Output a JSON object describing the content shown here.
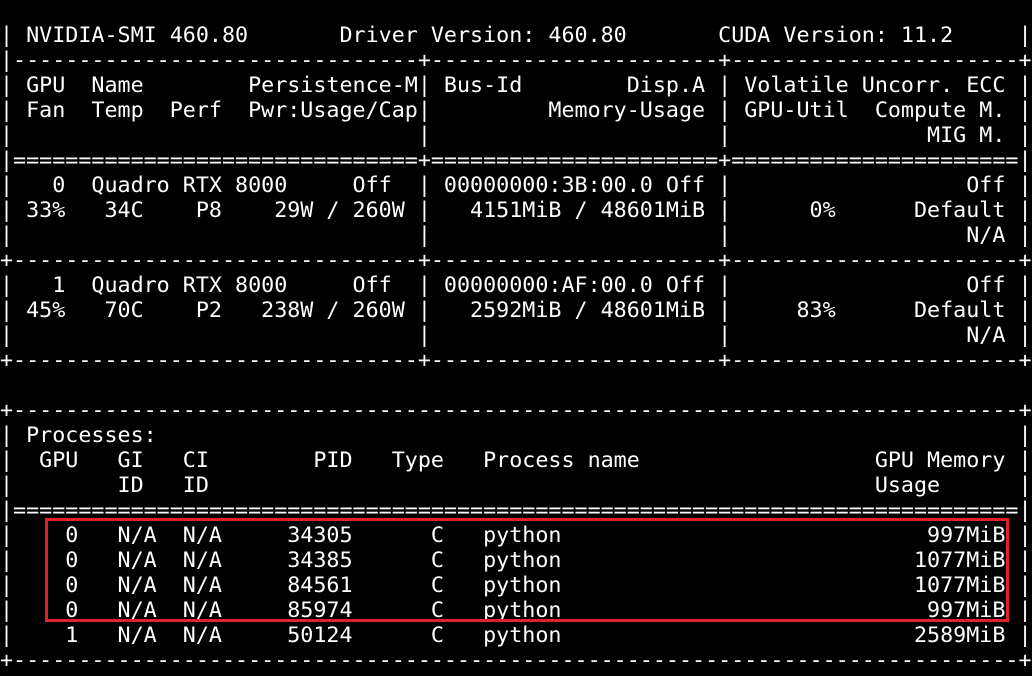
{
  "terminal": {
    "lines": [
      "| NVIDIA-SMI 460.80       Driver Version: 460.80       CUDA Version: 11.2     |",
      "|-------------------------------+----------------------+----------------------+",
      "| GPU  Name        Persistence-M| Bus-Id        Disp.A | Volatile Uncorr. ECC |",
      "| Fan  Temp  Perf  Pwr:Usage/Cap|         Memory-Usage | GPU-Util  Compute M. |",
      "|                               |                      |               MIG M. |",
      "|===============================+======================+======================|",
      "|   0  Quadro RTX 8000     Off  | 00000000:3B:00.0 Off |                  Off |",
      "| 33%   34C    P8    29W / 260W |   4151MiB / 48601MiB |      0%      Default |",
      "|                               |                      |                  N/A |",
      "+-------------------------------+----------------------+----------------------+",
      "|   1  Quadro RTX 8000     Off  | 00000000:AF:00.0 Off |                  Off |",
      "| 45%   70C    P2   238W / 260W |   2592MiB / 48601MiB |     83%      Default |",
      "|                               |                      |                  N/A |",
      "+-------------------------------+----------------------+----------------------+",
      "",
      "+-----------------------------------------------------------------------------+",
      "| Processes:                                                                  |",
      "|  GPU   GI   CI        PID   Type   Process name                  GPU Memory |",
      "|        ID   ID                                                   Usage      |",
      "|=============================================================================|",
      "|    0   N/A  N/A     34305      C   python                            997MiB |",
      "|    0   N/A  N/A     34385      C   python                           1077MiB |",
      "|    0   N/A  N/A     84561      C   python                           1077MiB |",
      "|    0   N/A  N/A     85974      C   python                            997MiB |",
      "|    1   N/A  N/A     50124      C   python                           2589MiB |",
      "+-----------------------------------------------------------------------------+"
    ]
  },
  "colors": {
    "background": "#000000",
    "text": "#ffffff",
    "highlight": "#e2222a"
  }
}
